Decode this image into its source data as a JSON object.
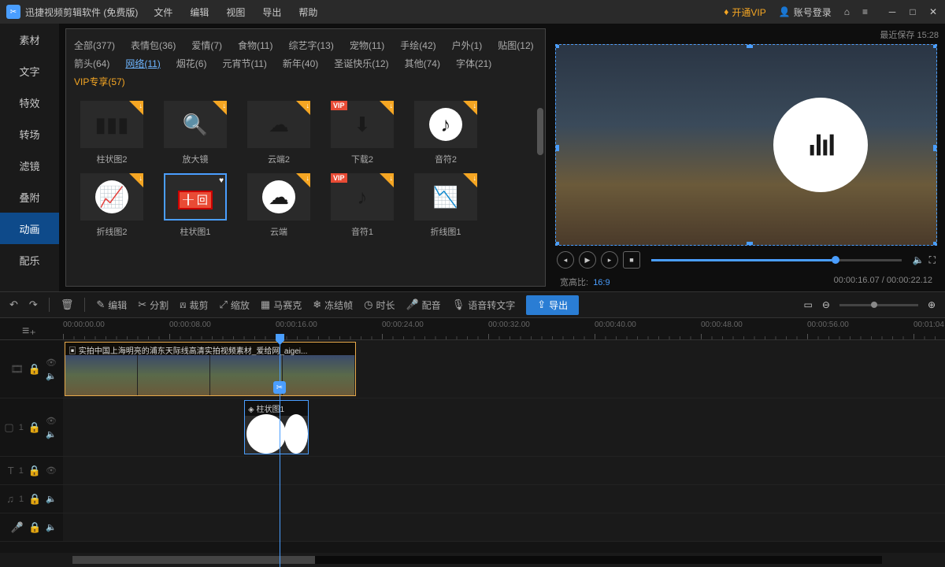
{
  "app_title": "迅捷视频剪辑软件 (免费版)",
  "menu": [
    "文件",
    "编辑",
    "视图",
    "导出",
    "帮助"
  ],
  "vip_label": "开通VIP",
  "login_label": "账号登录",
  "save_time": "最近保存 15:28",
  "side_tabs": [
    "素材",
    "文字",
    "特效",
    "转场",
    "滤镜",
    "叠附",
    "动画",
    "配乐"
  ],
  "active_side_tab": "动画",
  "categories": [
    {
      "label": "全部(377)"
    },
    {
      "label": "表情包(36)"
    },
    {
      "label": "爱情(7)"
    },
    {
      "label": "食物(11)"
    },
    {
      "label": "综艺字(13)"
    },
    {
      "label": "宠物(11)"
    },
    {
      "label": "手绘(42)"
    },
    {
      "label": "户外(1)"
    },
    {
      "label": "贴图(12)"
    },
    {
      "label": "箭头(64)"
    },
    {
      "label": "网络(11)",
      "active": true
    },
    {
      "label": "烟花(6)"
    },
    {
      "label": "元宵节(11)"
    },
    {
      "label": "新年(40)"
    },
    {
      "label": "圣诞快乐(12)"
    },
    {
      "label": "其他(74)"
    },
    {
      "label": "字体(21)"
    },
    {
      "label": "VIP专享(57)",
      "vip": true
    }
  ],
  "assets": [
    {
      "name": "柱状图2",
      "icon": "bar",
      "dl": true
    },
    {
      "name": "放大镜",
      "icon": "search",
      "dl": true
    },
    {
      "name": "云端2",
      "icon": "cloud",
      "dl": true
    },
    {
      "name": "下载2",
      "icon": "download",
      "dl": true,
      "vip": true
    },
    {
      "name": "音符2",
      "icon": "note",
      "dl": true,
      "white": true
    },
    {
      "name": "折线图2",
      "icon": "line",
      "dl": true,
      "white": true
    },
    {
      "name": "柱状图1",
      "icon": "bar2",
      "dl": false,
      "selected": true,
      "fav": true
    },
    {
      "name": "云端",
      "icon": "cloud",
      "dl": true,
      "white": true
    },
    {
      "name": "音符1",
      "icon": "note",
      "dl": true,
      "vip": true
    },
    {
      "name": "折线图1",
      "icon": "line2",
      "dl": true
    }
  ],
  "toolbar": {
    "undo": "↶",
    "redo": "↷",
    "delete": "🗑",
    "edit": "编辑",
    "split": "分割",
    "crop": "裁剪",
    "scale": "缩放",
    "mosaic": "马赛克",
    "freeze": "冻结帧",
    "duration": "时长",
    "dub": "配音",
    "stt": "语音转文字",
    "export": "导出"
  },
  "preview": {
    "aspect_label": "宽高比:",
    "aspect": "16:9",
    "time": "00:00:16.07 / 00:00:22.12"
  },
  "timeline": {
    "ticks": [
      "00:00:00.00",
      "00:00:08.00",
      "00:00:16.00",
      "00:00:24.00",
      "00:00:32.00",
      "00:00:40.00",
      "00:00:48.00",
      "00:00:56.00",
      "00:01:04"
    ],
    "clip1_label": "实拍中国上海明亮的浦东天际线高清实拍视频素材_爱给网_aigei...",
    "anim_clip_label": "柱状图1"
  }
}
